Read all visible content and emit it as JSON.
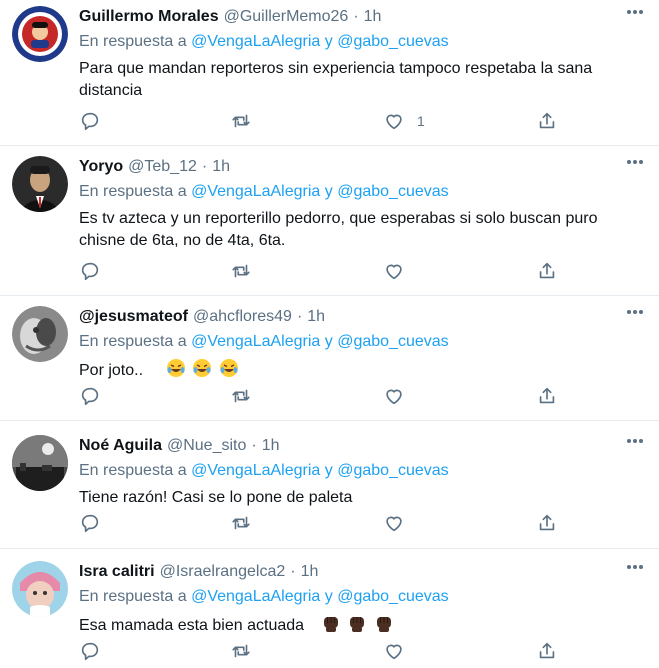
{
  "colors": {
    "name": "#0f1419",
    "muted": "#5b7083",
    "link": "#1da1f2",
    "divider": "#e6ecf0"
  },
  "reply_prefix": "En respuesta a",
  "reply_joiner": "y",
  "tweets": [
    {
      "name": "Guillermo Morales",
      "handle": "@GuillerMemo26",
      "dot": "·",
      "time": "1h",
      "mention1": "@VengaLaAlegria",
      "mention2": "@gabo_cuevas",
      "text": "Para que mandan reporteros sin experiencia tampoco respetaba la sana distancia",
      "like_count": "1"
    },
    {
      "name": "Yoryo",
      "handle": "@Teb_12",
      "dot": "·",
      "time": "1h",
      "mention1": "@VengaLaAlegria",
      "mention2": "@gabo_cuevas",
      "text": "Es tv azteca y un reporterillo pedorro, que esperabas si solo buscan puro chisne de 6ta, no de 4ta, 6ta.",
      "like_count": ""
    },
    {
      "name": "@jesusmateof",
      "handle": "@ahcflores49",
      "dot": "·",
      "time": "1h",
      "mention1": "@VengaLaAlegria",
      "mention2": "@gabo_cuevas",
      "text": "Por joto..",
      "emoji": [
        "face-with-tears-of-joy",
        "face-with-tears-of-joy",
        "face-with-tears-of-joy"
      ],
      "like_count": ""
    },
    {
      "name": "Noé Aguila",
      "handle": "@Nue_sito",
      "dot": "·",
      "time": "1h",
      "mention1": "@VengaLaAlegria",
      "mention2": "@gabo_cuevas",
      "text": "Tiene razón! Casi se lo pone de paleta",
      "like_count": ""
    },
    {
      "name": "Isra calitri",
      "handle": "@Israelrangelca2",
      "dot": "·",
      "time": "1h",
      "mention1": "@VengaLaAlegria",
      "mention2": "@gabo_cuevas",
      "text": "Esa mamada esta bien actuada",
      "emoji": [
        "raised-fist-dark",
        "raised-fist-dark",
        "raised-fist-dark"
      ],
      "like_count": ""
    }
  ]
}
